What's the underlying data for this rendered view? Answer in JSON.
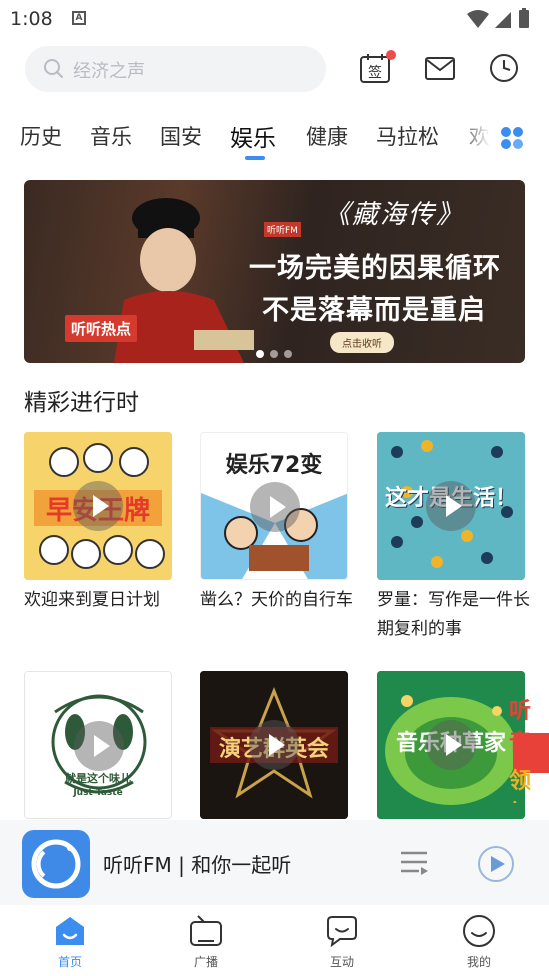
{
  "status_bar": {
    "time": "1:08",
    "a_icon": "A"
  },
  "search": {
    "placeholder": "经济之声"
  },
  "header": {
    "sign_label": "签"
  },
  "tabs": [
    "历史",
    "音乐",
    "国安",
    "娱乐",
    "健康",
    "马拉松",
    "欢"
  ],
  "active_tab": "娱乐",
  "banner": {
    "title": "《藏海传》",
    "line1": "一场完美的因果循环",
    "line2": "不是落幕而是重启",
    "logo_text": "听听FM",
    "tag": "听听热点",
    "cta": "点击收听",
    "dots": 3,
    "active_dot": 0
  },
  "section": {
    "title": "精彩进行时"
  },
  "cards": [
    {
      "title": "欢迎来到夏日计划",
      "cover_text": "早安王牌"
    },
    {
      "title": "凿么？天价的自行车",
      "cover_text": "娱乐72变"
    },
    {
      "title": "罗量：写作是一件长期复利的事",
      "cover_text": "这才是生活！"
    },
    {
      "title": "",
      "cover_text": "就是这个味儿",
      "cover_sub": "Just Taste"
    },
    {
      "title": "",
      "cover_text": "演艺群英会"
    },
    {
      "title": "",
      "cover_text": "音乐种草家"
    }
  ],
  "peek_text": {
    "top": "听音",
    "bottom": "领红"
  },
  "mini_player": {
    "title": "听听FM | 和你一起听"
  },
  "nav": [
    {
      "label": "首页",
      "icon": "home-icon",
      "active": true
    },
    {
      "label": "广播",
      "icon": "radio-icon",
      "active": false
    },
    {
      "label": "互动",
      "icon": "chat-icon",
      "active": false
    },
    {
      "label": "我的",
      "icon": "profile-icon",
      "active": false
    }
  ],
  "colors": {
    "accent": "#3b8df0",
    "badge": "#f04b4b"
  }
}
